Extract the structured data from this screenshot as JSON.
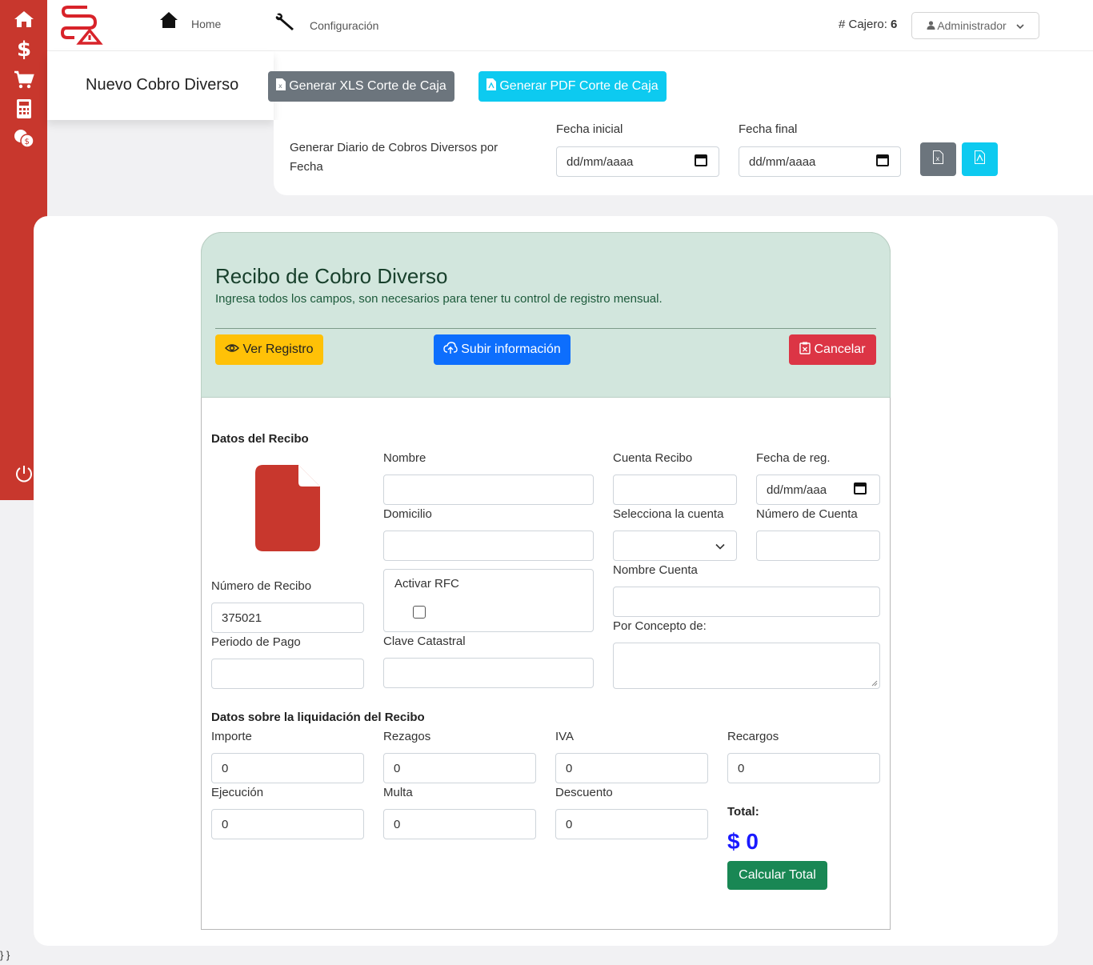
{
  "nav": {
    "home": "Home",
    "config": "Configuración",
    "cajero_label": "# Cajero:",
    "cajero_num": "6",
    "user": "Administrador"
  },
  "header": {
    "title": "Nuevo Cobro Diverso",
    "btn_xls": "Generar XLS Corte de Caja",
    "btn_pdf": "Generar PDF Corte de Caja"
  },
  "date_range": {
    "caption_1": "Generar Diario de Cobros Diversos por",
    "caption_2": "Fecha",
    "start_label": "Fecha inicial",
    "start_value": "dd/mm/aaaa",
    "end_label": "Fecha final",
    "end_value": "dd/mm/aaaa"
  },
  "form": {
    "title": "Recibo de Cobro Diverso",
    "subtitle": "Ingresa todos los campos, son necesarios para tener tu control de registro mensual.",
    "btn_ver": "Ver Registro",
    "btn_subir": "Subir información",
    "btn_cancelar": "Cancelar"
  },
  "recibo": {
    "section": "Datos del Recibo",
    "numero_label": "Número de Recibo",
    "numero_value": "375021",
    "periodo_label": "Periodo de Pago",
    "periodo_value": "",
    "nombre_label": "Nombre",
    "nombre_value": "",
    "domicilio_label": "Domicilio",
    "domicilio_value": "",
    "rfc_label": "Activar RFC",
    "clave_label": "Clave Catastral",
    "clave_value": "",
    "cuenta_recibo_label": "Cuenta Recibo",
    "cuenta_recibo_value": "",
    "fecha_reg_label": "Fecha de reg.",
    "fecha_reg_value": "dd/mm/aaa",
    "selecciona_label": "Selecciona la cuenta",
    "selecciona_value": "",
    "num_cuenta_label": "Número de Cuenta",
    "num_cuenta_value": "",
    "nombre_cuenta_label": "Nombre Cuenta",
    "nombre_cuenta_value": "",
    "concepto_label": "Por Concepto de:"
  },
  "liquidacion": {
    "section": "Datos sobre la liquidación del Recibo",
    "importe_label": "Importe",
    "importe_value": "0",
    "rezagos_label": "Rezagos",
    "rezagos_value": "0",
    "iva_label": "IVA",
    "iva_value": "0",
    "recargos_label": "Recargos",
    "recargos_value": "0",
    "ejecucion_label": "Ejecución",
    "ejecucion_value": "0",
    "multa_label": "Multa",
    "multa_value": "0",
    "descuento_label": "Descuento",
    "descuento_value": "0",
    "total_label": "Total:",
    "total_value": "$ 0",
    "btn_calcular": "Calcular Total"
  },
  "footer_text": "} }",
  "colors": {
    "sidebar": "#c8372d",
    "form_header": "#d2e6dd",
    "total": "#1a1aff"
  },
  "icons": {
    "sidebar": [
      "home-icon",
      "dollar-icon",
      "cart-icon",
      "calculator-icon",
      "coins-icon",
      "power-icon"
    ]
  }
}
